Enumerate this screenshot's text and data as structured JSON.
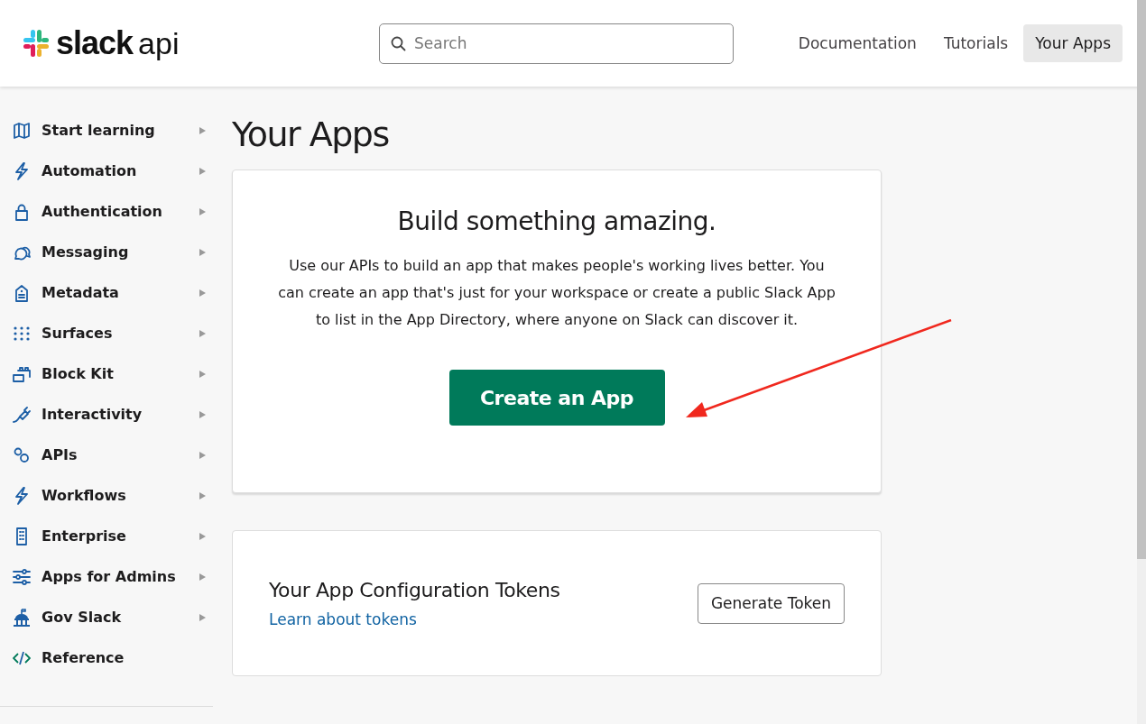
{
  "header": {
    "logo_text": "slack",
    "logo_suffix": "api",
    "search": {
      "placeholder": "Search"
    },
    "nav": [
      {
        "label": "Documentation",
        "selected": false
      },
      {
        "label": "Tutorials",
        "selected": false
      },
      {
        "label": "Your Apps",
        "selected": true
      }
    ]
  },
  "sidebar": {
    "items": [
      {
        "label": "Start learning",
        "has_submenu": true
      },
      {
        "label": "Automation",
        "has_submenu": true
      },
      {
        "label": "Authentication",
        "has_submenu": true
      },
      {
        "label": "Messaging",
        "has_submenu": true
      },
      {
        "label": "Metadata",
        "has_submenu": true
      },
      {
        "label": "Surfaces",
        "has_submenu": true
      },
      {
        "label": "Block Kit",
        "has_submenu": true
      },
      {
        "label": "Interactivity",
        "has_submenu": true
      },
      {
        "label": "APIs",
        "has_submenu": true
      },
      {
        "label": "Workflows",
        "has_submenu": true
      },
      {
        "label": "Enterprise",
        "has_submenu": true
      },
      {
        "label": "Apps for Admins",
        "has_submenu": true
      },
      {
        "label": "Gov Slack",
        "has_submenu": true
      },
      {
        "label": "Reference",
        "has_submenu": false
      }
    ]
  },
  "page_title": "Your Apps",
  "intro_card": {
    "heading": "Build something amazing.",
    "text": "Use our APIs to build an app that makes people's working lives better. You can create an app that's just for your workspace or create a public Slack App to list in the App Directory, where anyone on Slack can discover it.",
    "button": "Create an App"
  },
  "tokens_card": {
    "heading": "Your App Configuration Tokens",
    "link": "Learn about tokens",
    "button": "Generate Token"
  }
}
